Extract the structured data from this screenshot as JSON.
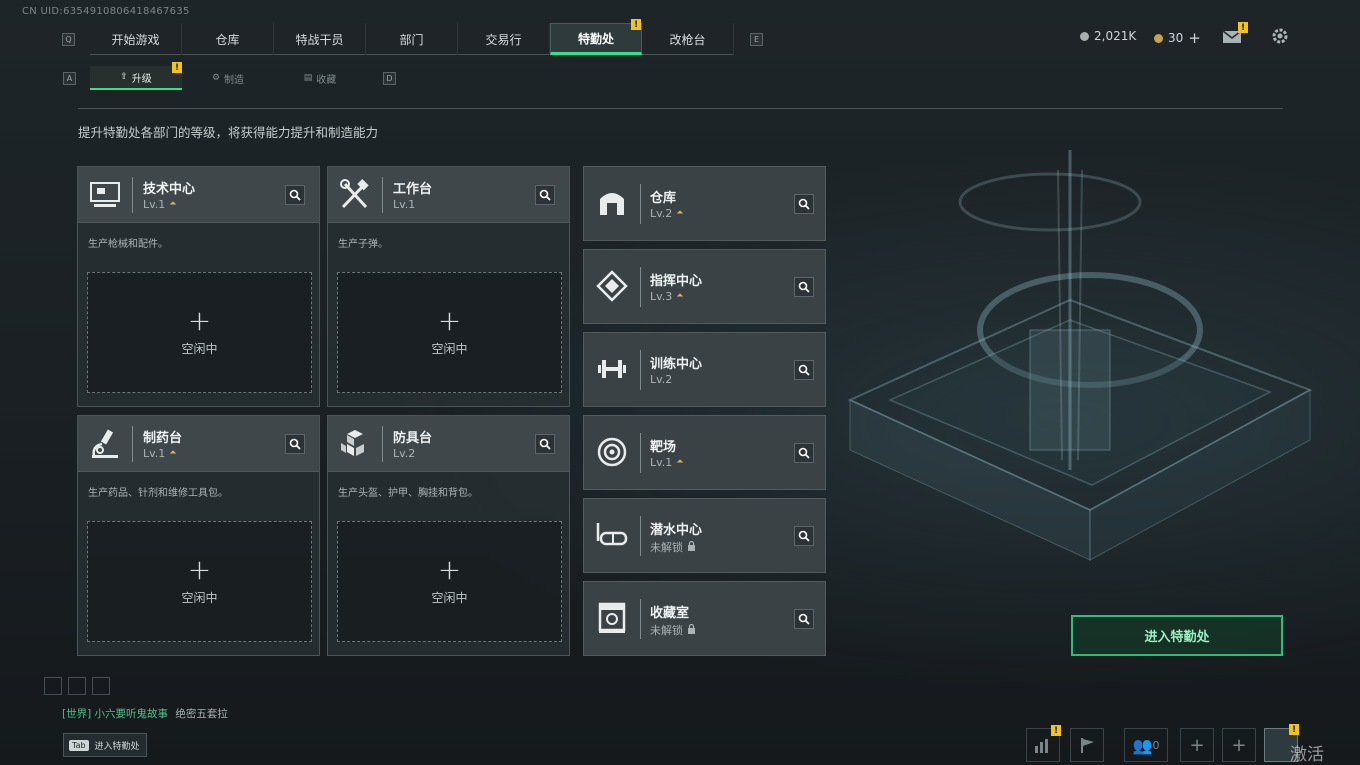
{
  "uid": "CN UID:6354910806418467635",
  "top_tabs": [
    {
      "label": "开始游戏"
    },
    {
      "label": "仓库"
    },
    {
      "label": "特战干员"
    },
    {
      "label": "部门"
    },
    {
      "label": "交易行"
    },
    {
      "label": "特勤处",
      "active": true
    },
    {
      "label": "改枪台"
    }
  ],
  "key_hints": {
    "left_tab": "Q",
    "right_tab": "E",
    "left_sub": "A",
    "right_sub": "D"
  },
  "sub_tabs": [
    {
      "label": "升级",
      "active": true
    },
    {
      "label": "制造"
    },
    {
      "label": "收藏"
    }
  ],
  "resources": {
    "silver": "2,021K",
    "gold": "30",
    "gold_add": "+"
  },
  "notice_mark": "!",
  "description": "提升特勤处各部门的等级，将获得能力提升和制造能力",
  "work_cards": [
    {
      "title": "技术中心",
      "level": "Lv.1",
      "desc": "生产枪械和配件。",
      "slot": "空闲中",
      "plus": "+"
    },
    {
      "title": "工作台",
      "level": "Lv.1",
      "desc": "生产子弹。",
      "slot": "空闲中",
      "plus": "+"
    },
    {
      "title": "制药台",
      "level": "Lv.1",
      "desc": "生产药品、针剂和维修工具包。",
      "slot": "空闲中",
      "plus": "+"
    },
    {
      "title": "防具台",
      "level": "Lv.2",
      "desc": "生产头盔、护甲、胸挂和背包。",
      "slot": "空闲中",
      "plus": "+"
    }
  ],
  "facilities": [
    {
      "title": "仓库",
      "level": "Lv.2"
    },
    {
      "title": "指挥中心",
      "level": "Lv.3"
    },
    {
      "title": "训练中心",
      "level": "Lv.2"
    },
    {
      "title": "靶场",
      "level": "Lv.1"
    },
    {
      "title": "潜水中心",
      "level": "未解锁"
    },
    {
      "title": "收藏室",
      "level": "未解锁"
    }
  ],
  "enter_button": "进入特勤处",
  "chat": {
    "channel": "[世界]",
    "user": "小六要听鬼故事",
    "message": "绝密五套拉"
  },
  "tab_hint": {
    "key": "Tab",
    "label": "进入特勤处"
  },
  "party_count": "0",
  "watermark": "激活 Windows",
  "colors": {
    "accent": "#2ee58a",
    "notice": "#f0c419",
    "background": "#1b2225"
  }
}
